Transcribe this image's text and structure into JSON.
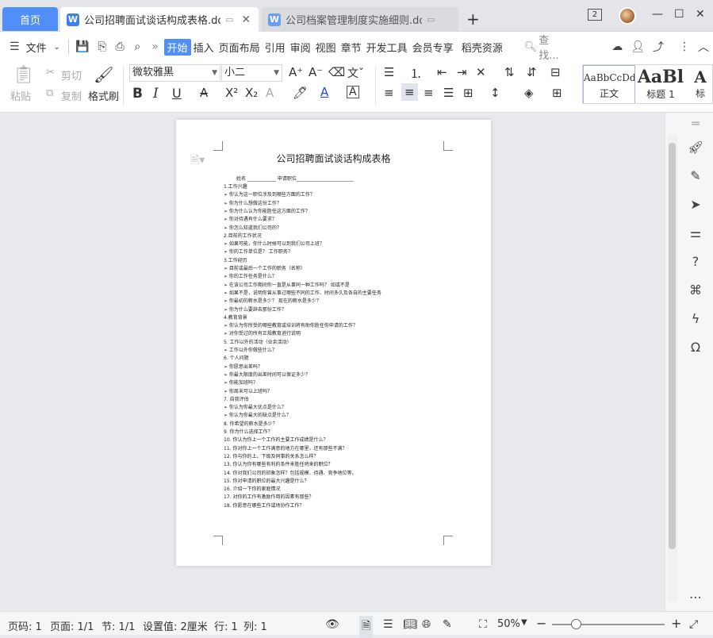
{
  "tabs": {
    "home": "首页",
    "active_doc": "公司招聘面试谈话构成表格.doc",
    "inactive_doc": "公司档案管理制度实施细则.doc",
    "add": "+",
    "badge": "2"
  },
  "window": {
    "minimize": "—",
    "restore": "☐",
    "close": "✕"
  },
  "menu": {
    "file": "文件",
    "items": [
      "开始",
      "插入",
      "页面布局",
      "引用",
      "审阅",
      "视图",
      "章节",
      "开发工具",
      "会员专享",
      "稻壳资源"
    ],
    "search": "查找..."
  },
  "toolbar": {
    "paste": "粘贴",
    "cut": "剪切",
    "copy": "复制",
    "format_painter": "格式刷",
    "font_name": "微软雅黑",
    "font_size": "小二",
    "styles": [
      {
        "preview": "AaBbCcDd",
        "label": "正文"
      },
      {
        "preview": "AaBl",
        "label": "标题 1"
      },
      {
        "preview": "A",
        "label": "标"
      }
    ]
  },
  "document": {
    "title": "公司招聘面试谈话构成表格",
    "lines": [
      "姓名 ____________                      申请职位________________________",
      "1.工作兴趣",
      "➢   你认为这一职位涉及到哪些方面的工作？",
      "➢   你为什么想做这份工作？",
      "➢   你为什么认为你能胜任这方面的工作？",
      "➢   你对待遇有什么要求？",
      "➢   你怎么知道我们公司的？",
      "2.目前的工作状况",
      "➢   如果可能，你什么时候可以到我们公司上班？",
      "➢   你的工作单位是？    工作职务？",
      "3.工作经历",
      "➢   目前或最后一个工作的职务（名称）",
      "➢   你的工作任务是什么？",
      "➢   在该公司工作期间你一直是从事同一种工作吗？  如或不是",
      "➢   如果不是，说明你曾从事过哪些不同的工作、时间多久及各自的主要任务",
      "➢   你最初的薪水是多少？  现在的薪水是多少？",
      "➢   你为什么要辞去那份工作？",
      "4.教育背景",
      "➢   你认为你所受的哪些教育或培训将有助你胜任你申请的工作？",
      "➢   对你受过的所有正规教育进行说明",
      "5. 工作以外的活动（业余活动）",
      "➢   工作以外你做些什么？",
      "6. 个人问题",
      "➢   你愿意出差吗？",
      "➢   你最大限度的出差时间可以保证多少？",
      "➢   你能加班吗？",
      "➢   你周末可以上班吗？",
      "7. 自我评估",
      "➢   你认为你最大优点是什么？",
      "➢   你认为你最大的缺点是什么？",
      "8. 你希望的薪水是多少？",
      "9. 你为什么选择工作？",
      "10. 你认为你上一个工作的主要工作成绩是什么？",
      "11. 你对你上一个工作满意的地方在哪里，还有那些不满？",
      "12. 你与你的上、下级及同事的关系怎么样？",
      "13. 你认为你有哪些有利的条件来胜任将来的职位？",
      "14. 你对我们公司的印象怎样？包括规模、待遇、竞争地位等。",
      "15. 你对申请的职位的最大兴趣是什么？",
      "16. 介绍一下你的家庭情况",
      "17. 对你的工作有激励作用的因素有那些？",
      "18. 你愿意在哪些工作或场协作工作？"
    ]
  },
  "status": {
    "page": "页码: 1",
    "pages": "页面: 1/1",
    "section": "节: 1/1",
    "setting": "设置值: 2厘米",
    "row": "行: 1",
    "col": "列: 1",
    "zoom": "50%"
  },
  "colors": {
    "accent": "#4f8ff7",
    "word_icon": "#3d7ef0",
    "inactive_icon": "#6b9ef2"
  }
}
